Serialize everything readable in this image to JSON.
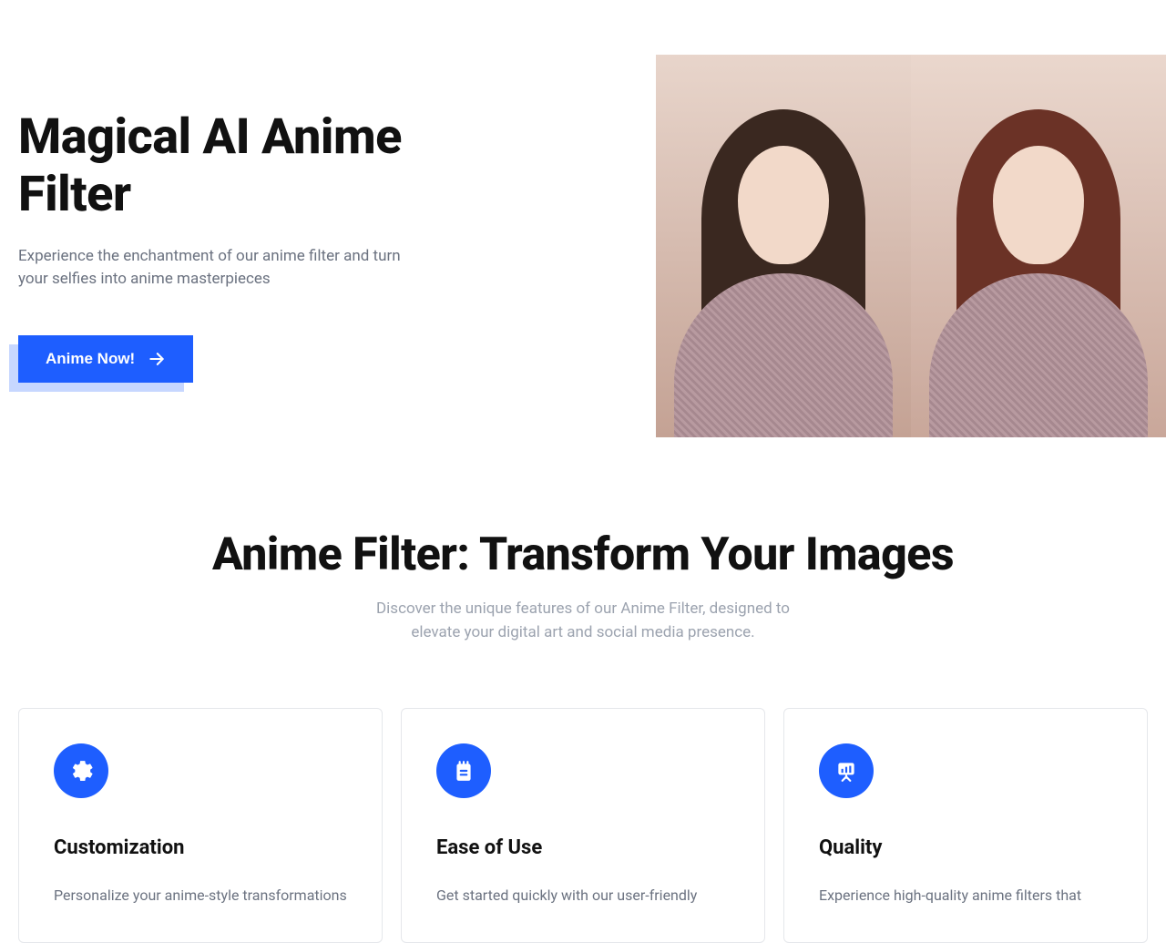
{
  "hero": {
    "title": "Magical AI Anime Filter",
    "subtitle": "Experience the enchantment of our anime filter and turn your selfies into anime masterpieces",
    "cta_label": "Anime Now!"
  },
  "section": {
    "title": "Anime Filter: Transform Your Images",
    "subtitle": "Discover the unique features of our Anime Filter, designed to elevate your digital art and social media presence."
  },
  "features": [
    {
      "icon": "gear-icon",
      "title": "Customization",
      "description": "Personalize your anime-style transformations"
    },
    {
      "icon": "notepad-icon",
      "title": "Ease of Use",
      "description": "Get started quickly with our user-friendly"
    },
    {
      "icon": "presentation-icon",
      "title": "Quality",
      "description": "Experience high-quality anime filters that"
    }
  ],
  "colors": {
    "primary": "#1e5eff",
    "text_muted": "#6b7280"
  }
}
